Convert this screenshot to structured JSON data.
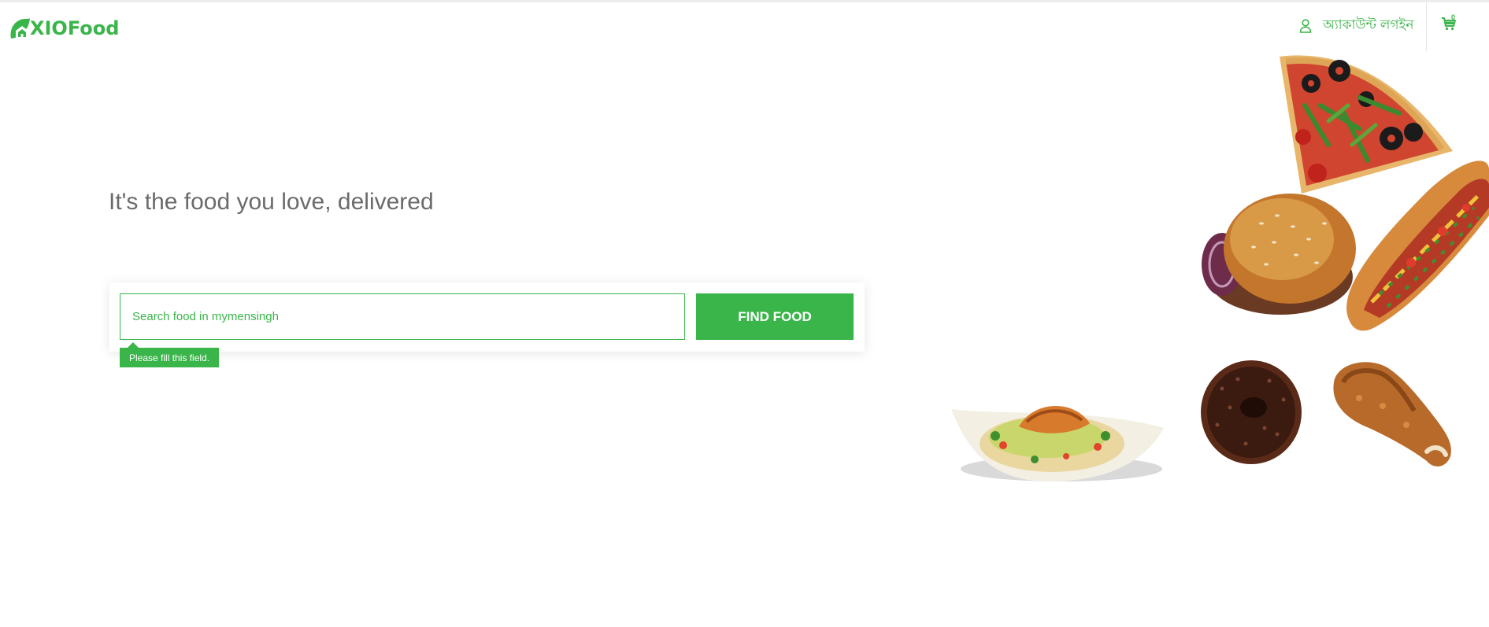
{
  "header": {
    "logo_text": "XIOFood",
    "login_label": "অ্যাকাউন্ট লগইন",
    "cart_count": "0"
  },
  "hero": {
    "headline": "It's the food you love, delivered",
    "search_placeholder": "Search food in mymensingh",
    "search_value": "",
    "find_button": "FIND FOOD",
    "validation_tooltip": "Please fill this field."
  },
  "colors": {
    "brand_green": "#3ab54a",
    "headline_gray": "#6b6b6b"
  },
  "icons": [
    "user-icon",
    "cart-icon",
    "logo-leaf-icon"
  ],
  "images": [
    "pizza-slice",
    "burger",
    "hot-dog",
    "salad-plate",
    "chocolate-donut",
    "fried-chicken-leg"
  ]
}
